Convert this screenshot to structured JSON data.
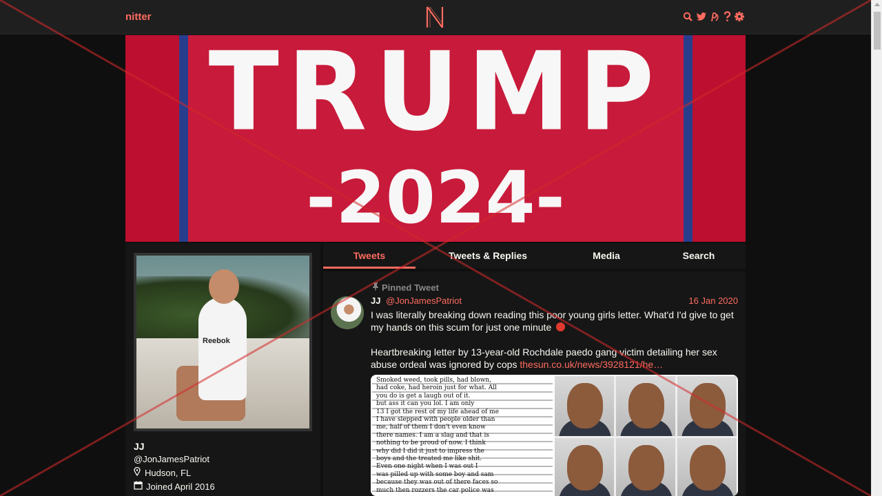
{
  "navbar": {
    "brand": "nitter",
    "logo_letter": "N",
    "icons": [
      "search-icon",
      "twitter-bird-icon",
      "rss-icon",
      "help-icon",
      "gear-icon"
    ]
  },
  "banner": {
    "line1": "TRUMP",
    "line2": "-2024-"
  },
  "profile": {
    "fullname": "JJ",
    "username": "@JonJamesPatriot",
    "location": "Hudson, FL",
    "joined": "Joined April 2016",
    "shirt_text": "Reebok"
  },
  "tabs": [
    {
      "label": "Tweets",
      "active": true
    },
    {
      "label": "Tweets & Replies",
      "active": false
    },
    {
      "label": "Media",
      "active": false
    },
    {
      "label": "Search",
      "active": false
    }
  ],
  "tweet": {
    "pinned_label": "Pinned Tweet",
    "fullname": "JJ",
    "username": "@JonJamesPatriot",
    "date": "16 Jan 2020",
    "text1": "I was literally breaking down reading this poor young girls letter. What'd I'd give to get my hands on this scum for just one minute",
    "text2": "Heartbreaking letter by 13-year-old Rochdale paedo gang victim detailing her sex abuse ordeal was ignored by cops",
    "link": "thesun.co.uk/news/3928121/he…",
    "letter_lines": [
      "Smoked weed, took pills, had blown,",
      "had coke, had heroin just for what. All",
      "you do is get a laugh out of it.",
      "but ass it can you lol. I am only",
      "13 I got the rest of my life ahead of me",
      "I have slepped with people older than",
      "me, half of them I don't even know",
      "there names. I am a slag and that is",
      "nothing to be proud of now. I think",
      "why did I did it just to impress the",
      "boys and the treated me like shit.",
      "Even one night when I was out I",
      "was pilled up with some boy and sam",
      "because they was out of there faces so",
      "much then rozzers the car police was"
    ]
  },
  "colors": {
    "accent": "#ff6c60",
    "background": "#0f0f0f",
    "panel": "#161616",
    "navbar": "#1f1f1f",
    "banner_red": "#c81a3a",
    "banner_blue": "#283e8c"
  }
}
